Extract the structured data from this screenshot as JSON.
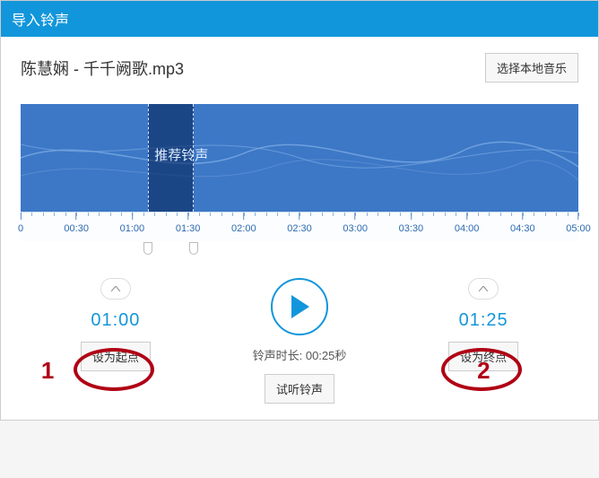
{
  "titlebar": {
    "title": "导入铃声"
  },
  "file": {
    "name": "陈慧娴 - 千千阙歌.mp3",
    "select_btn": "选择本地音乐"
  },
  "waveform": {
    "recommend_label": "推荐铃声",
    "selection": {
      "start_pct": 22.8,
      "end_pct": 31.0
    },
    "ticks": [
      "0",
      "00:30",
      "01:00",
      "01:30",
      "02:00",
      "02:30",
      "03:00",
      "03:30",
      "04:00",
      "04:30",
      "05:00"
    ]
  },
  "controls": {
    "start": {
      "time": "01:00",
      "btn": "设为起点"
    },
    "end": {
      "time": "01:25",
      "btn": "设为终点"
    },
    "duration_label": "铃声时长: 00:25秒",
    "preview_btn": "试听铃声"
  },
  "annotations": {
    "num1": "1",
    "num2": "2"
  }
}
